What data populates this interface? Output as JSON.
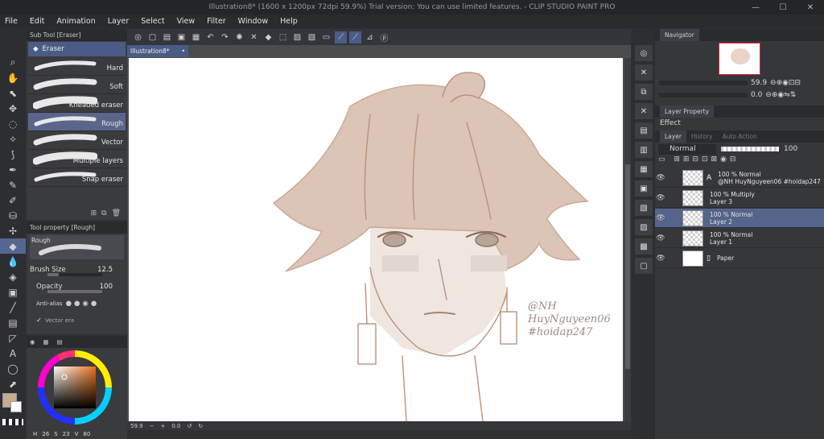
{
  "window": {
    "title": "Illustration8* (1600 x 1200px 72dpi 59.9%)  Trial version: You can use limited features. - CLIP STUDIO PAINT PRO",
    "controls": [
      "—",
      "☐",
      "✕"
    ]
  },
  "menu": [
    "File",
    "Edit",
    "Animation",
    "Layer",
    "Select",
    "View",
    "Filter",
    "Window",
    "Help"
  ],
  "subtool": {
    "header": "Sub Tool [Eraser]",
    "group": "Eraser",
    "brushes": [
      {
        "label": "Hard"
      },
      {
        "label": "Soft"
      },
      {
        "label": "Kneaded eraser"
      },
      {
        "label": "Rough"
      },
      {
        "label": "Vector"
      },
      {
        "label": "Multiple layers"
      },
      {
        "label": "Snap eraser"
      }
    ],
    "selected": 3
  },
  "toolprop": {
    "header": "Tool property [Rough]",
    "preset": "Rough",
    "brush_size_label": "Brush Size",
    "brush_size_value": "12.5",
    "opacity_label": "Opacity",
    "opacity_value": "100",
    "antialias_label": "Anti-alias",
    "vector_label": "Vector era"
  },
  "color": {
    "main_color": "#c8a992",
    "sub_color": "#ffffff",
    "readout": [
      "26",
      "23",
      "80"
    ]
  },
  "canvas": {
    "tab": "Illustration8*",
    "zoom": "59.9",
    "angle": "0.0",
    "watermark": [
      "@NH",
      "HuyNguyeen06",
      "#hoidap247"
    ]
  },
  "navigator": {
    "header": "Navigator",
    "zoom": "59.9",
    "rotate": "0.0"
  },
  "layerprop": {
    "header": "Layer Property",
    "effect": "Effect"
  },
  "layer_panel": {
    "tabs": [
      "Layer",
      "History",
      "Auto Action"
    ],
    "blend": "Normal",
    "opacity": "100",
    "layers": [
      {
        "l1": "100 % Normal",
        "l2": "@NH HuyNguyeen06 #hoidap247",
        "type": "text"
      },
      {
        "l1": "100 % Multiply",
        "l2": "Layer 3",
        "type": "raster"
      },
      {
        "l1": "100 % Normal",
        "l2": "Layer 2",
        "type": "raster"
      },
      {
        "l1": "100 % Normal",
        "l2": "Layer 1",
        "type": "raster"
      },
      {
        "l1": "",
        "l2": "Paper",
        "type": "paper"
      }
    ],
    "selected": 2
  },
  "accent": "#4a5c85"
}
